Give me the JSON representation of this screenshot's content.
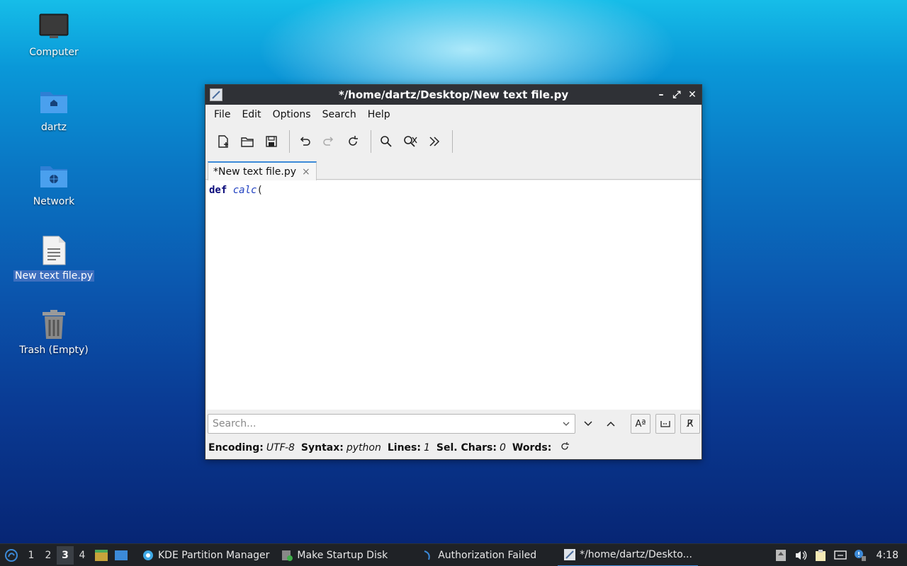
{
  "desktop": {
    "icons": [
      {
        "label": "Computer"
      },
      {
        "label": "dartz"
      },
      {
        "label": "Network"
      },
      {
        "label": "New text file.py"
      },
      {
        "label": "Trash (Empty)"
      }
    ]
  },
  "window": {
    "title": "*/home/dartz/Desktop/New text file.py",
    "controls": {
      "minimize": "–",
      "maximize": "⤢",
      "close": "✕"
    },
    "menus": [
      "File",
      "Edit",
      "Options",
      "Search",
      "Help"
    ],
    "tab": {
      "label": "*New text file.py",
      "close": "×"
    },
    "code": {
      "keyword": "def",
      "function": "calc",
      "punct": "("
    },
    "search": {
      "placeholder": "Search..."
    },
    "case_btn": "Aª",
    "regex_btn": "R̸",
    "status": {
      "encoding_label": "Encoding:",
      "encoding": "UTF-8",
      "syntax_label": "Syntax:",
      "syntax": "python",
      "lines_label": "Lines:",
      "lines": "1",
      "selchars_label": "Sel. Chars:",
      "selchars": "0",
      "words_label": "Words:"
    }
  },
  "taskbar": {
    "workspaces": [
      "1",
      "2",
      "3",
      "4"
    ],
    "active_workspace": "3",
    "tasks": [
      {
        "label": "KDE Partition Manager"
      },
      {
        "label": "Make Startup Disk"
      },
      {
        "label": "Authorization Failed"
      },
      {
        "label": "*/home/dartz/Deskto..."
      }
    ],
    "clock": "4:18"
  }
}
